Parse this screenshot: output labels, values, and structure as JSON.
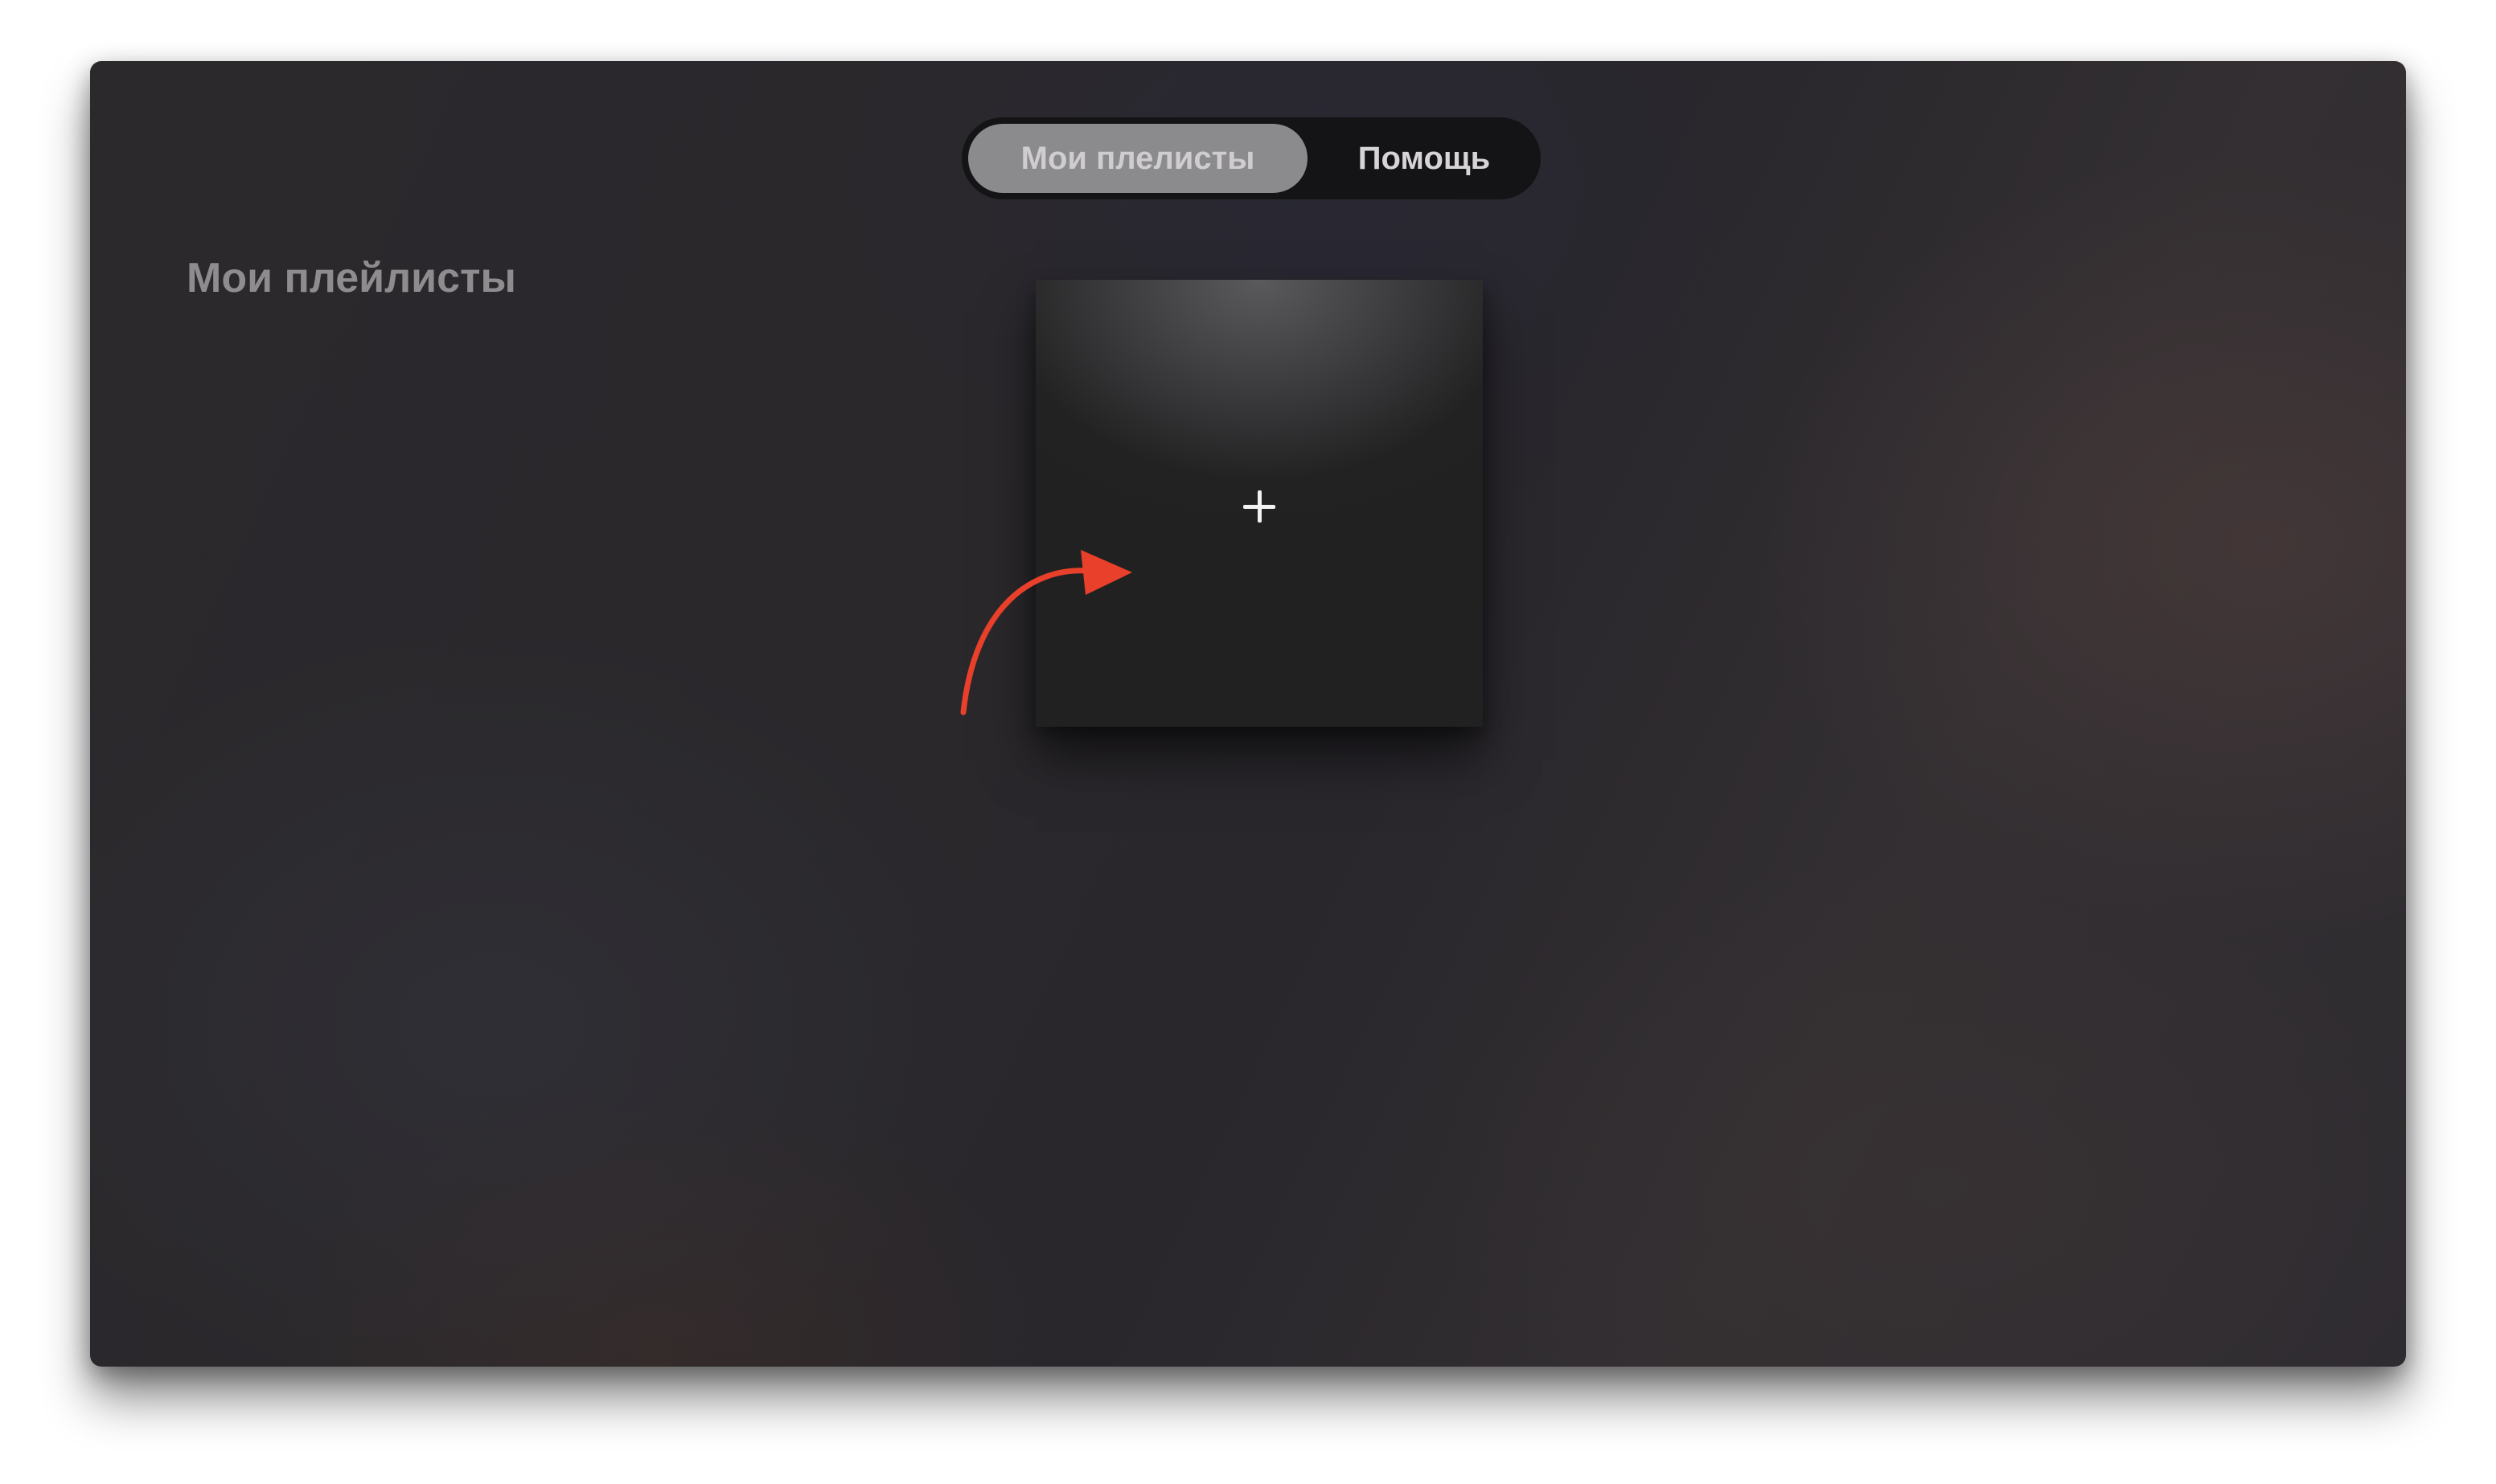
{
  "tabs": [
    {
      "label": "Мои плелисты",
      "active": true
    },
    {
      "label": "Помощь",
      "active": false
    }
  ],
  "section": {
    "title": "Мои плейлисты"
  },
  "add_tile": {
    "icon": "plus-icon"
  },
  "annotation": {
    "icon": "curved-arrow-icon",
    "color": "#e8402a"
  },
  "colors": {
    "background": "#2b292c",
    "tab_active_bg": "#8b8a8c",
    "tabbar_bg": "#141315",
    "arrow": "#e8402a"
  }
}
